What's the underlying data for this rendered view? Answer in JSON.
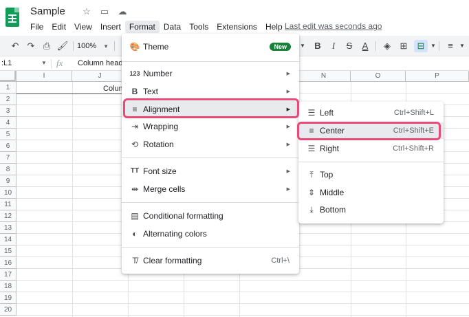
{
  "app": {
    "doc_title": "Sample",
    "last_edit": "Last edit was seconds ago",
    "title_icons": [
      "star-icon",
      "move-to-folder-icon",
      "cloud-saved-icon"
    ]
  },
  "menubar": [
    "File",
    "Edit",
    "View",
    "Insert",
    "Format",
    "Data",
    "Tools",
    "Extensions",
    "Help"
  ],
  "active_menu": "Format",
  "toolbar": {
    "zoom": "100%",
    "icons": [
      "undo-icon",
      "redo-icon",
      "print-icon",
      "paint-format-icon",
      "bold-icon",
      "italic-icon",
      "strikethrough-icon",
      "text-color-icon",
      "fill-color-icon",
      "borders-icon",
      "merge-cells-icon",
      "horizontal-align-icon"
    ]
  },
  "formula_bar": {
    "name_box": ":L1",
    "fx": "fx",
    "content": "Column heade"
  },
  "grid": {
    "columns": [
      "I",
      "J",
      "N",
      "O",
      "P"
    ],
    "rows": [
      "1",
      "2",
      "3",
      "4",
      "5",
      "6",
      "7",
      "8",
      "9",
      "10",
      "11",
      "12",
      "13",
      "14",
      "15",
      "16",
      "17",
      "18",
      "19",
      "20"
    ],
    "cell_text": "Colum"
  },
  "format_menu": {
    "theme": {
      "label": "Theme",
      "badge": "New"
    },
    "items": [
      {
        "label": "Number",
        "icon": "123",
        "arrow": "▶"
      },
      {
        "label": "Text",
        "icon": "B",
        "arrow": "▶"
      },
      {
        "label": "Alignment",
        "icon": "≡",
        "arrow": "▶"
      },
      {
        "label": "Wrapping",
        "icon": "⇥",
        "arrow": "▶"
      },
      {
        "label": "Rotation",
        "icon": "⟲",
        "arrow": "▶"
      }
    ],
    "items2": [
      {
        "label": "Font size",
        "icon": "TT",
        "arrow": "▶"
      },
      {
        "label": "Merge cells",
        "icon": "⇹",
        "arrow": "▶"
      }
    ],
    "items3": [
      {
        "label": "Conditional formatting",
        "icon": "▤"
      },
      {
        "label": "Alternating colors",
        "icon": "◐"
      }
    ],
    "clear": {
      "label": "Clear formatting",
      "shortcut": "Ctrl+\\"
    }
  },
  "alignment_menu": {
    "horizontal": [
      {
        "label": "Left",
        "shortcut": "Ctrl+Shift+L"
      },
      {
        "label": "Center",
        "shortcut": "Ctrl+Shift+E"
      },
      {
        "label": "Right",
        "shortcut": "Ctrl+Shift+R"
      }
    ],
    "vertical": [
      {
        "label": "Top"
      },
      {
        "label": "Middle"
      },
      {
        "label": "Bottom"
      }
    ]
  },
  "colors": {
    "highlight_box": "#ea4a78",
    "badge_green": "#188038",
    "sheets_green": "#0f9d58"
  }
}
